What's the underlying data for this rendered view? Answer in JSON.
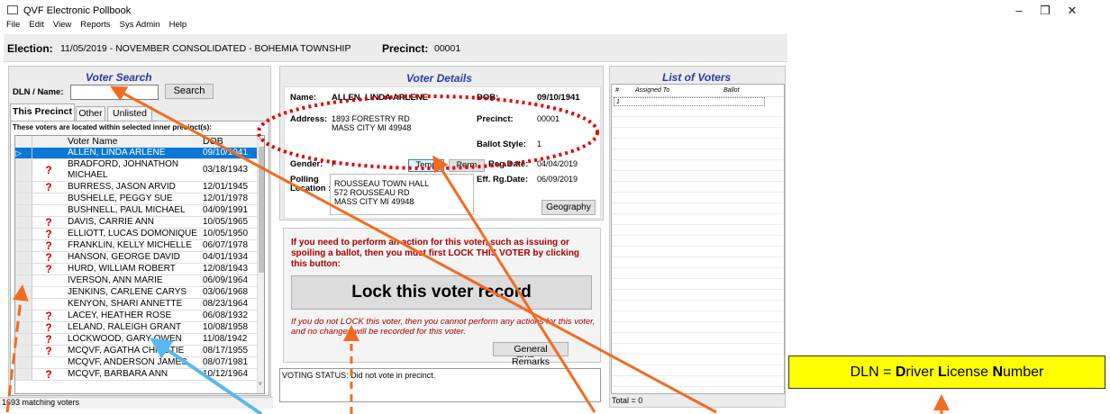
{
  "window": {
    "title": "QVF Electronic Pollbook",
    "minimize": "–",
    "maximize": "❐",
    "close": "✕"
  },
  "menu": [
    "File",
    "Edit",
    "View",
    "Reports",
    "Sys Admin",
    "Help"
  ],
  "election": {
    "label": "Election:",
    "value": "11/05/2019 - NOVEMBER CONSOLIDATED - BOHEMIA TOWNSHIP",
    "precinct_label": "Precinct:",
    "precinct_value": "00001"
  },
  "search": {
    "title": "Voter Search",
    "dln_label": "DLN / Name:",
    "input_value": "",
    "button": "Search"
  },
  "tabs": [
    "This Precinct",
    "Other",
    "Unlisted"
  ],
  "inner_note": "These voters are located within selected inner precinct(s):",
  "grid": {
    "headers": {
      "name": "Voter Name",
      "dob": "DOB"
    },
    "rows": [
      {
        "mark": "▷",
        "q": "",
        "name": "ALLEN, LINDA ARLENE",
        "dob": "09/10/1941"
      },
      {
        "mark": "",
        "q": "?",
        "name": "BRADFORD, JOHNATHON",
        "name2": "MICHAEL",
        "dob": "03/18/1943"
      },
      {
        "mark": "",
        "q": "?",
        "name": "BURRESS, JASON ARVID",
        "dob": "12/01/1945"
      },
      {
        "mark": "",
        "q": "",
        "name": "BUSHELLE, PEGGY SUE",
        "dob": "12/01/1978"
      },
      {
        "mark": "",
        "q": "",
        "name": "BUSHNELL, PAUL MICHAEL",
        "dob": "04/09/1991"
      },
      {
        "mark": "",
        "q": "?",
        "name": "DAVIS, CARRIE ANN",
        "dob": "10/05/1965"
      },
      {
        "mark": "",
        "q": "?",
        "name": "ELLIOTT, LUCAS DOMONIQUE",
        "dob": "10/05/1950"
      },
      {
        "mark": "",
        "q": "?",
        "name": "FRANKLIN, KELLY MICHELLE",
        "dob": "06/07/1978"
      },
      {
        "mark": "",
        "q": "?",
        "name": "HANSON, GEORGE DAVID",
        "dob": "04/01/1934"
      },
      {
        "mark": "",
        "q": "?",
        "name": "HURD, WILLIAM ROBERT",
        "dob": "12/08/1943"
      },
      {
        "mark": "",
        "q": "",
        "name": "IVERSON, ANN MARIE",
        "dob": "06/09/1964"
      },
      {
        "mark": "",
        "q": "",
        "name": "JENKINS, CARLENE CARYS",
        "dob": "03/06/1968"
      },
      {
        "mark": "",
        "q": "",
        "name": "KENYON, SHARI ANNETTE",
        "dob": "08/23/1964"
      },
      {
        "mark": "",
        "q": "?",
        "name": "LACEY, HEATHER ROSE",
        "dob": "06/08/1932"
      },
      {
        "mark": "",
        "q": "?",
        "name": "LELAND, RALEIGH GRANT",
        "dob": "10/08/1958"
      },
      {
        "mark": "",
        "q": "?",
        "name": "LOCKWOOD, GARY OWEN",
        "dob": "11/08/1942"
      },
      {
        "mark": "",
        "q": "?",
        "name": "MCQVF, AGATHA CHRISTIE",
        "dob": "08/17/1955"
      },
      {
        "mark": "",
        "q": "",
        "name": "MCQVF, ANDERSON JAMES",
        "dob": "08/07/1981"
      },
      {
        "mark": "",
        "q": "?",
        "name": "MCQVF, BARBARA ANN",
        "dob": "10/12/1964"
      }
    ]
  },
  "status_count": "1693 matching voters",
  "details": {
    "title": "Voter Details",
    "name_label": "Name:",
    "name": "ALLEN, LINDA ARLENE",
    "dob_label": "DOB:",
    "dob": "09/10/1941",
    "address_label": "Address:",
    "address1": "1893 FORESTRY RD",
    "address2": "MASS CITY MI 49948",
    "precinct_label": "Precinct:",
    "precinct": "00001",
    "ballot_label": "Ballot Style:",
    "ballot": "1",
    "gender_label": "Gender:",
    "gender": "F",
    "temp_btn": "Temp",
    "perm_btn": "Perm",
    "regdate_label": "Reg.Date:",
    "regdate": "04/04/2019",
    "effdate_label": "Eff. Rg.Date:",
    "effdate": "06/09/2019",
    "polling_label1": "Polling",
    "polling_label2": "Location :",
    "polling1": "ROUSSEAU TOWN HALL",
    "polling2": "572 ROUSSEAU RD",
    "polling3": "MASS CITY MI 49948",
    "geography_btn": "Geography"
  },
  "lock": {
    "instruction": "If you need to perform an action for this voter, such as issuing or spoiling a ballot, then you must first LOCK THIS VOTER by clicking this button:",
    "button": "Lock this voter record",
    "warning": "If you do not LOCK this voter, then you cannot perform any actions for this voter, and no changes will be recorded for this voter.",
    "remarks_btn": "General Remarks",
    "remarks_btn_behind": "arks"
  },
  "voting_status": "VOTING STATUS: Did not vote in precinct.",
  "list": {
    "title": "List of Voters",
    "col_num": "#",
    "col_assigned": "Assigned To",
    "col_ballot": "Ballot",
    "first_row": "1",
    "total": "Total = 0"
  },
  "annotation": {
    "pre": "DLN = ",
    "d": "D",
    "river": "river ",
    "l": "L",
    "icense": "icense ",
    "n": "N",
    "umber": "umber"
  },
  "colors": {
    "arrow": "#f26b21",
    "arrow_blue": "#58b8f0",
    "ellipse": "#e00000",
    "select": "#0a78d7",
    "title_blue": "#2a3ca0"
  }
}
